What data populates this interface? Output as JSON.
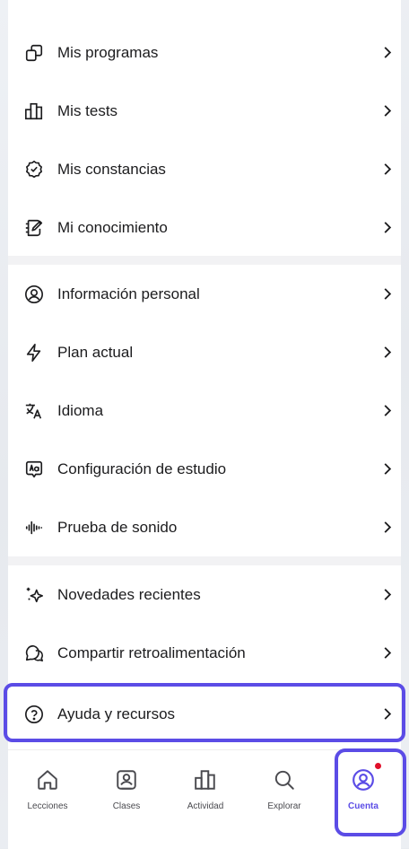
{
  "menu": {
    "learning": [
      {
        "label": "Mis programas",
        "icon": "copy-icon"
      },
      {
        "label": "Mis tests",
        "icon": "bar-chart-icon"
      },
      {
        "label": "Mis constancias",
        "icon": "certificate-icon"
      },
      {
        "label": "Mi conocimiento",
        "icon": "notebook-edit-icon"
      }
    ],
    "settings": [
      {
        "label": "Información personal",
        "icon": "user-circle-icon"
      },
      {
        "label": "Plan actual",
        "icon": "lightning-icon"
      },
      {
        "label": "Idioma",
        "icon": "translate-icon"
      },
      {
        "label": "Configuración de estudio",
        "icon": "study-settings-icon"
      },
      {
        "label": "Prueba de sonido",
        "icon": "sound-wave-icon"
      }
    ],
    "support": [
      {
        "label": "Novedades recientes",
        "icon": "sparkle-icon"
      },
      {
        "label": "Compartir retroalimentación",
        "icon": "feedback-icon"
      },
      {
        "label": "Ayuda y recursos",
        "icon": "help-circle-icon"
      }
    ]
  },
  "tabbar": {
    "tabs": [
      {
        "label": "Lecciones",
        "icon": "home-icon"
      },
      {
        "label": "Clases",
        "icon": "classes-icon"
      },
      {
        "label": "Actividad",
        "icon": "activity-icon"
      },
      {
        "label": "Explorar",
        "icon": "search-icon"
      },
      {
        "label": "Cuenta",
        "icon": "account-icon"
      }
    ],
    "active": "Cuenta"
  },
  "colors": {
    "accent": "#5b4ce6",
    "notification": "#e0102a"
  }
}
